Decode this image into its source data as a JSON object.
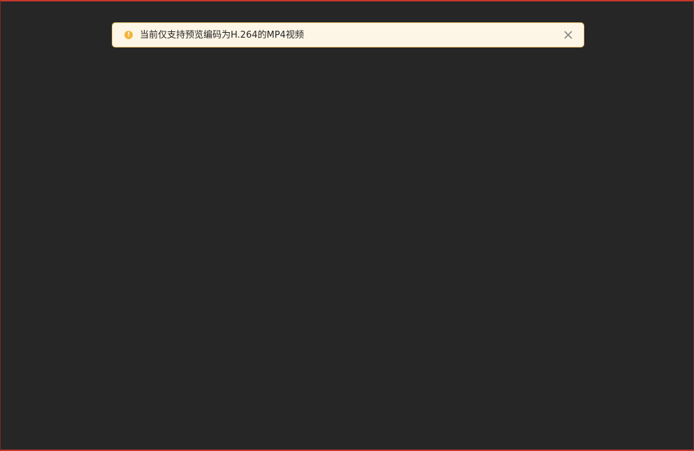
{
  "notice": {
    "type": "warning",
    "icon": "exclamation-circle-icon",
    "icon_glyph": "!",
    "message": "当前仅支持预览编码为H.264的MP4视频",
    "close_icon": "close-icon"
  },
  "colors": {
    "background": "#262626",
    "frame_border": "#c8372e",
    "alert_background": "#fdf6e7",
    "alert_border": "#f0c46a",
    "warning_icon": "#f4b43c",
    "close_icon": "#8c8c8c"
  }
}
